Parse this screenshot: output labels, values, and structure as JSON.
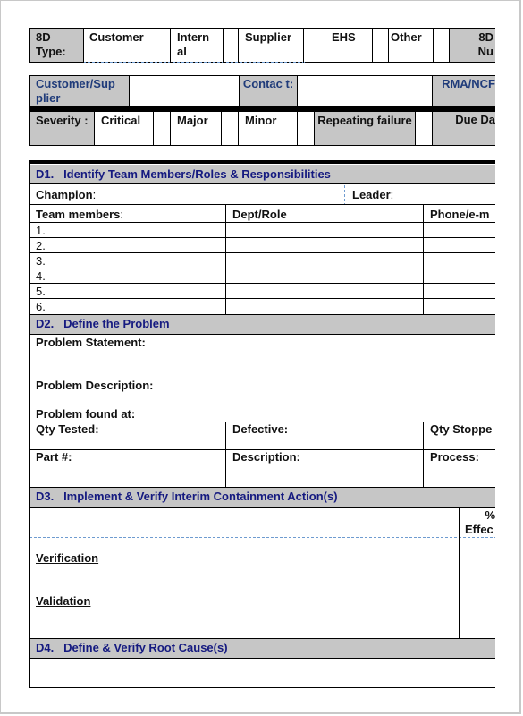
{
  "header": {
    "type_row": {
      "label": "8D Type:",
      "options": [
        "Customer",
        "Intern al",
        "Supplier",
        "EHS",
        "Other"
      ],
      "number_label": "8D Nu"
    },
    "customer_row": {
      "customer_label": "Customer/Sup plier",
      "contact_label": "Contac t:",
      "rma_label": "RMA/NCF"
    },
    "severity_row": {
      "label": "Severity :",
      "options": [
        "Critical",
        "Major",
        "Minor"
      ],
      "repeating_label": "Repeating failure",
      "due_label": "Due Da"
    }
  },
  "d1": {
    "title": "D1.   Identify Team Members/Roles & Responsibilities",
    "champion_label": "Champion",
    "leader_label": "Leader",
    "colon": ":",
    "columns": [
      "Team members",
      "Dept/Role",
      "Phone/e-m"
    ],
    "rows": [
      "1.",
      "2.",
      "3.",
      "4.",
      "5.",
      "6."
    ]
  },
  "d2": {
    "title": "D2.   Define the Problem",
    "problem_statement": "Problem Statement:",
    "problem_description": "Problem Description:",
    "problem_found": "Problem found at:",
    "qty_tested": "Qty Tested:",
    "defective": "Defective:",
    "qty_stopped": "Qty Stoppe",
    "part": "Part #:",
    "description": "Description:",
    "process": "Process:"
  },
  "d3": {
    "title": "D3.   Implement & Verify Interim Containment Action(s)",
    "effective_pct": "%",
    "effective_label": "Effec",
    "verification": "Verification",
    "validation": "Validation"
  },
  "d4": {
    "title": "D4.   Define & Verify Root Cause(s)"
  }
}
